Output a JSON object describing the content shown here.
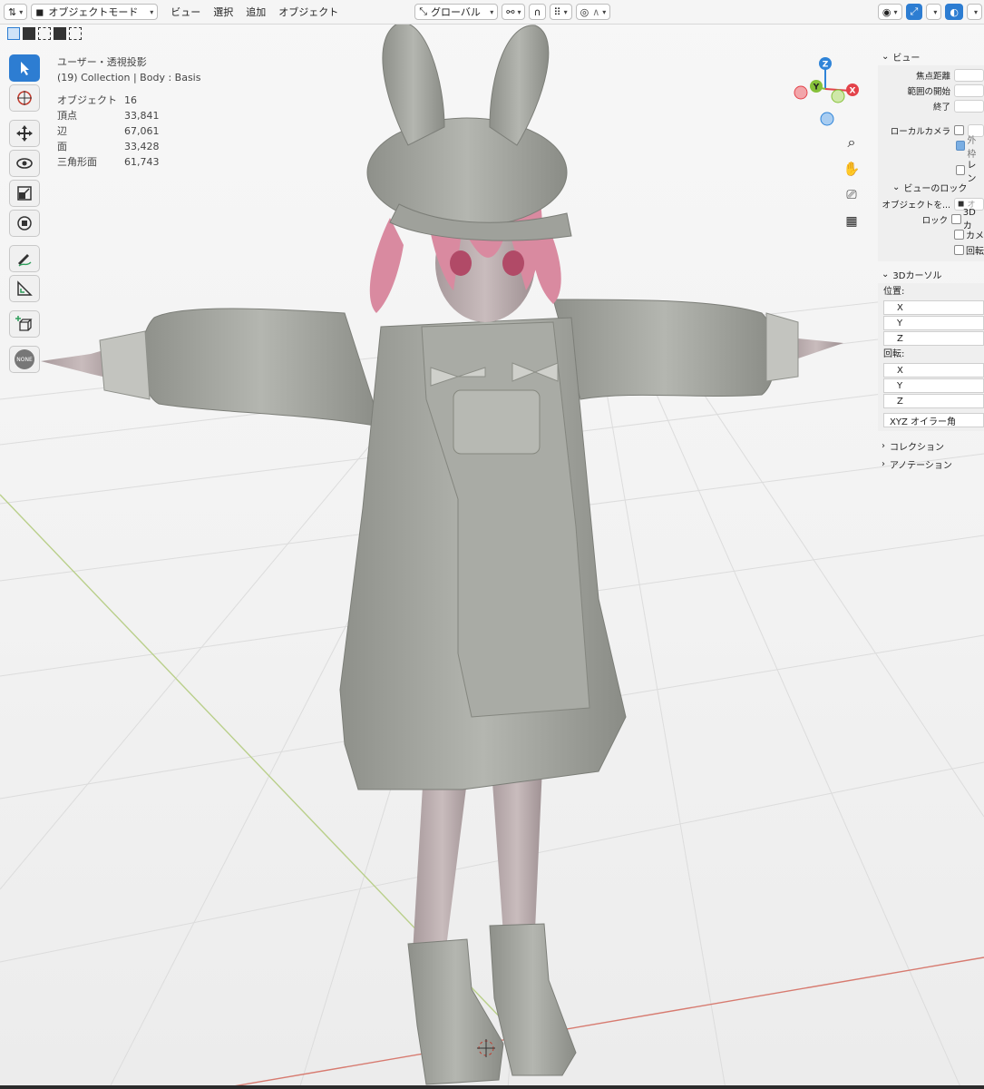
{
  "header": {
    "editor_icon": "view3d-editor-icon",
    "mode_label": "オブジェクトモード",
    "menus": [
      "ビュー",
      "選択",
      "追加",
      "オブジェクト"
    ],
    "orientation_label": "グローバル",
    "snap_label": "∧"
  },
  "overlay": {
    "view_name": "ユーザー・透視投影",
    "collection_text": "(19) Collection | Body : Basis",
    "stats": [
      {
        "label": "オブジェクト",
        "value": "16"
      },
      {
        "label": "頂点",
        "value": "33,841"
      },
      {
        "label": "辺",
        "value": "67,061"
      },
      {
        "label": "面",
        "value": "33,428"
      },
      {
        "label": "三角形面",
        "value": "61,743"
      }
    ]
  },
  "toolbar": {
    "none_label": "NONE"
  },
  "gizmo": {
    "z": "Z",
    "y": "Y",
    "x": "X",
    "colors": {
      "x": "#e3424a",
      "y": "#86c13a",
      "z": "#2f84d8"
    }
  },
  "panel": {
    "view_title": "ビュー",
    "focal_length": "焦点距離",
    "clip_start": "範囲の開始",
    "clip_end": "終了",
    "local_camera": "ローカルカメラ",
    "outer_frame": "外枠",
    "render_region": "レン",
    "view_lock_title": "ビューのロック",
    "lock_object": "オブジェクトを...",
    "lock_object_field": "オ",
    "lock_label": "ロック",
    "lock_3d": "3Dカ",
    "lock_camera": "カメ",
    "lock_rotation": "回転",
    "cursor_title": "3Dカーソル",
    "location": "位置:",
    "rotation": "回転:",
    "x": "X",
    "y": "Y",
    "z": "Z",
    "rotation_mode": "XYZ オイラー角",
    "collection": "コレクション",
    "annotation": "アノテーション"
  },
  "theme": {
    "accent": "#2d7dd2",
    "hair": "#d98aa0",
    "mesh": "#a3a59f",
    "x_axis": "#d77a6f",
    "y_axis": "#b9cf8a"
  }
}
